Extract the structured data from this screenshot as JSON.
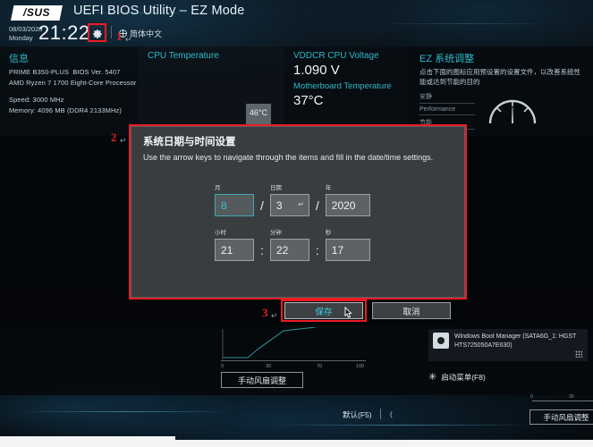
{
  "header": {
    "logo": "/SUS",
    "title": "UEFI BIOS Utility – EZ Mode",
    "date": "08/03/2020",
    "weekday": "Monday",
    "time": "21:22",
    "gear_icon": "gear-icon",
    "language": "简体中文"
  },
  "info_panel": {
    "title": "信息",
    "board": "PRIME B350-PLUS",
    "bios_version": "BIOS Ver. 5407",
    "cpu": "AMD Ryzen 7 1700 Eight-Core Processor",
    "speed": "Speed: 3000 MHz",
    "memory": "Memory: 4096 MB (DDR4 2133MHz)"
  },
  "cpu_panel": {
    "label": "CPU Temperature",
    "value": "46°C"
  },
  "voltage_panel": {
    "label": "VDDCR CPU Voltage",
    "value": "1.090 V",
    "mb_label": "Motherboard Temperature",
    "mb_value": "37°C"
  },
  "ez_panel": {
    "title": "EZ 系统调整",
    "desc": "点击下面的图标应用预设置的设置文件，以改善系统性能或达到节能的目的",
    "options": [
      "安静",
      "Performance",
      "节能"
    ],
    "gauge_icon": "gauge-icon"
  },
  "dialog": {
    "title": "系统日期与时间设置",
    "desc": "Use the arrow keys to navigate through the items and fill in the date/time settings.",
    "fields": {
      "month_label": "月",
      "month_value": "8",
      "day_label": "日期",
      "day_value": "3",
      "year_label": "年",
      "year_value": "2020",
      "hour_label": "小时",
      "hour_value": "21",
      "minute_label": "分钟",
      "minute_value": "22",
      "second_label": "秒",
      "second_value": "17",
      "date_sep": "/",
      "time_sep": ":",
      "enter_glyph": "↵"
    },
    "buttons": {
      "save": "保存",
      "cancel": "取消"
    }
  },
  "fan_chart": {
    "ticks": [
      "0",
      "30",
      "70",
      "100"
    ],
    "button": "手动风扇调整"
  },
  "boot": {
    "device": "Windows Boot Manager (SATA6G_1: HGST HTS725050A7E630)",
    "menu": "启动菜单(F8)",
    "hdd_icon": "hard-drive-icon",
    "star_icon": "sun-icon"
  },
  "footer": {
    "default": "默认(F5)",
    "more": "(",
    "fan_button": "手动风扇调整",
    "ticks": [
      "0",
      "30"
    ]
  },
  "annotations": {
    "step1": "1",
    "step2": "2",
    "step3": "3",
    "arrow": "↵",
    "color": "#ec1c24"
  }
}
